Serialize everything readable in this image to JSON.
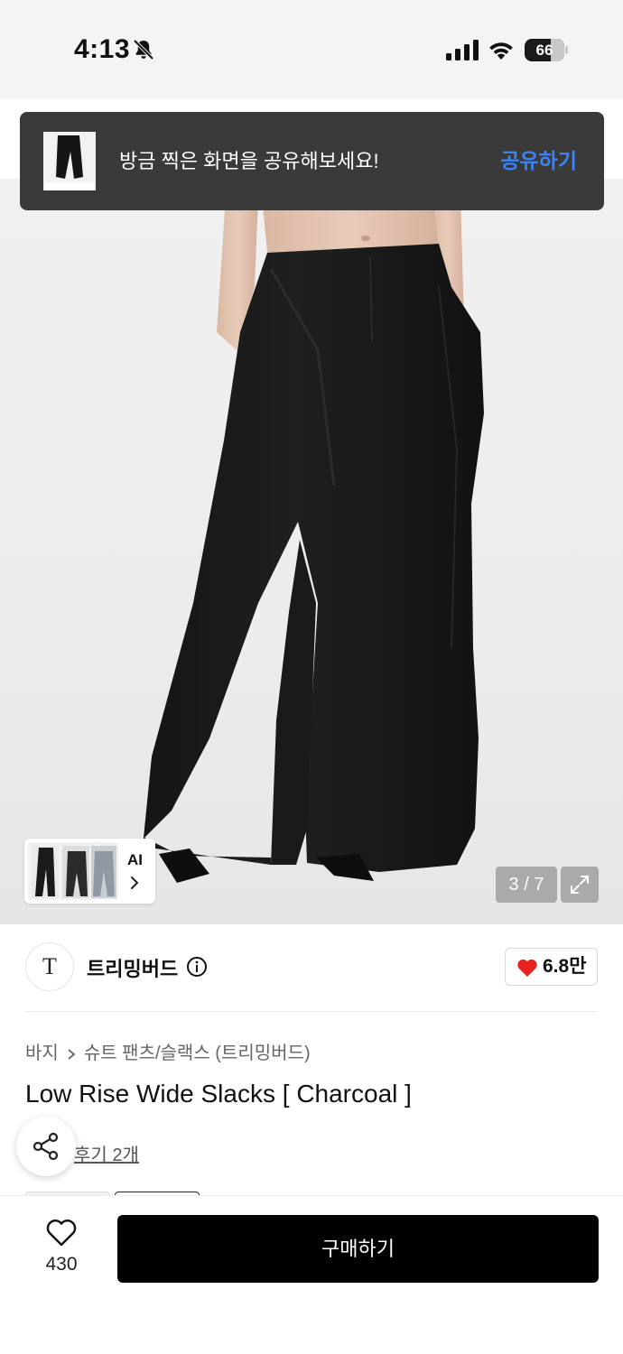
{
  "status_bar": {
    "time": "4:13",
    "battery": "66",
    "battery_level": 0.66,
    "icons": [
      "bell-slash-icon",
      "cellular-signal-icon",
      "wifi-icon",
      "battery-icon"
    ]
  },
  "toast": {
    "message": "방금 찍은 화면을 공유해보세요!",
    "action": "공유하기",
    "action_color": "#3b82f6"
  },
  "gallery": {
    "ai_label": "AI",
    "counter": "3 / 7",
    "current": 3,
    "total": 7
  },
  "brand": {
    "logo_text": "T",
    "name": "트리밍버드",
    "likes": "6.8만",
    "like_color": "#e8231e"
  },
  "product": {
    "breadcrumb": [
      "바지",
      "슈트 팬츠/슬랙스 (트리밍버드)"
    ],
    "title": "Low Rise Wide Slacks [ Charcoal ]",
    "review_text": "후기 2개"
  },
  "bottom_bar": {
    "wish_count": "430",
    "buy_label": "구매하기"
  }
}
